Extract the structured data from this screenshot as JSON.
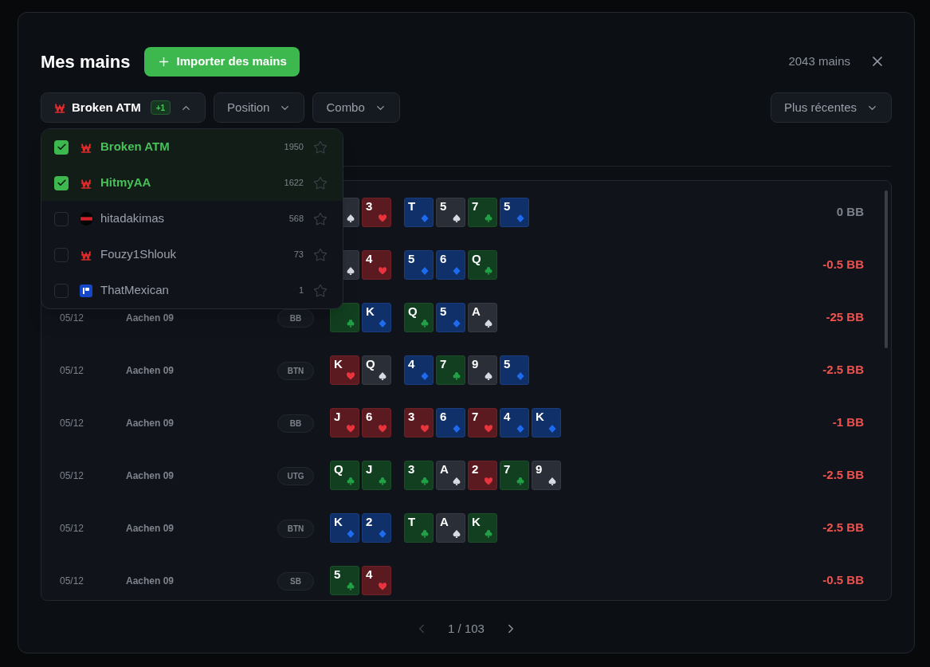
{
  "title": "Mes mains",
  "import_button": "Importer des mains",
  "hand_count": "2043 mains",
  "filters": [
    {
      "kind": "player",
      "label": "Broken ATM",
      "badge": "+1",
      "logo": {
        "kind": "w"
      },
      "expanded": true
    },
    {
      "kind": "plain",
      "label": "Position",
      "expanded": false
    },
    {
      "kind": "plain",
      "label": "Combo",
      "expanded": false
    }
  ],
  "sort": {
    "label": "Plus récentes"
  },
  "players": [
    {
      "name": "Broken ATM",
      "count": "1950",
      "checked": true,
      "logo": {
        "kind": "w"
      }
    },
    {
      "name": "HitmyAA",
      "count": "1622",
      "checked": true,
      "logo": {
        "kind": "w"
      }
    },
    {
      "name": "hitadakimas",
      "count": "568",
      "checked": false,
      "logo": {
        "kind": "redblack"
      }
    },
    {
      "name": "Fouzy1Shlouk",
      "count": "73",
      "checked": false,
      "logo": {
        "kind": "w"
      }
    },
    {
      "name": "ThatMexican",
      "count": "1",
      "checked": false,
      "logo": {
        "kind": "blue"
      }
    }
  ],
  "hands": [
    {
      "hole": [
        {
          "kind": "spade"
        },
        {
          "rank": "3",
          "kind": "heart"
        }
      ],
      "board": [
        {
          "rank": "T",
          "kind": "diamond"
        },
        {
          "rank": "5",
          "kind": "spade"
        },
        {
          "rank": "7",
          "kind": "club"
        },
        {
          "rank": "5",
          "kind": "diamond"
        }
      ],
      "result": "0 BB",
      "kind": "even"
    },
    {
      "hole": [
        {
          "kind": "spade"
        },
        {
          "rank": "4",
          "kind": "heart"
        }
      ],
      "board": [
        {
          "rank": "5",
          "kind": "diamond"
        },
        {
          "rank": "6",
          "kind": "diamond"
        },
        {
          "rank": "Q",
          "kind": "club"
        }
      ],
      "result": "-0.5 BB",
      "kind": "loss"
    },
    {
      "date": "05/12",
      "table": "Aachen 09",
      "position": "BB",
      "hole": [
        {
          "kind": "club"
        },
        {
          "rank": "K",
          "kind": "diamond"
        }
      ],
      "board": [
        {
          "rank": "Q",
          "kind": "club"
        },
        {
          "rank": "5",
          "kind": "diamond"
        },
        {
          "rank": "A",
          "kind": "spade"
        }
      ],
      "result": "-25 BB",
      "kind": "loss"
    },
    {
      "date": "05/12",
      "table": "Aachen 09",
      "position": "BTN",
      "hole": [
        {
          "rank": "K",
          "kind": "heart"
        },
        {
          "rank": "Q",
          "kind": "spade"
        }
      ],
      "board": [
        {
          "rank": "4",
          "kind": "diamond"
        },
        {
          "rank": "7",
          "kind": "club"
        },
        {
          "rank": "9",
          "kind": "spade"
        },
        {
          "rank": "5",
          "kind": "diamond"
        }
      ],
      "result": "-2.5 BB",
      "kind": "loss"
    },
    {
      "date": "05/12",
      "table": "Aachen 09",
      "position": "BB",
      "hole": [
        {
          "rank": "J",
          "kind": "heart"
        },
        {
          "rank": "6",
          "kind": "heart"
        }
      ],
      "board": [
        {
          "rank": "3",
          "kind": "heart"
        },
        {
          "rank": "6",
          "kind": "diamond"
        },
        {
          "rank": "7",
          "kind": "heart"
        },
        {
          "rank": "4",
          "kind": "diamond"
        },
        {
          "rank": "K",
          "kind": "diamond"
        }
      ],
      "result": "-1 BB",
      "kind": "loss"
    },
    {
      "date": "05/12",
      "table": "Aachen 09",
      "position": "UTG",
      "hole": [
        {
          "rank": "Q",
          "kind": "club"
        },
        {
          "rank": "J",
          "kind": "club"
        }
      ],
      "board": [
        {
          "rank": "3",
          "kind": "club"
        },
        {
          "rank": "A",
          "kind": "spade"
        },
        {
          "rank": "2",
          "kind": "heart"
        },
        {
          "rank": "7",
          "kind": "club"
        },
        {
          "rank": "9",
          "kind": "spade"
        }
      ],
      "result": "-2.5 BB",
      "kind": "loss"
    },
    {
      "date": "05/12",
      "table": "Aachen 09",
      "position": "BTN",
      "hole": [
        {
          "rank": "K",
          "kind": "diamond"
        },
        {
          "rank": "2",
          "kind": "diamond"
        }
      ],
      "board": [
        {
          "rank": "T",
          "kind": "club"
        },
        {
          "rank": "A",
          "kind": "spade"
        },
        {
          "rank": "K",
          "kind": "club"
        }
      ],
      "result": "-2.5 BB",
      "kind": "loss"
    },
    {
      "date": "05/12",
      "table": "Aachen 09",
      "position": "SB",
      "hole": [
        {
          "rank": "5",
          "kind": "club"
        },
        {
          "rank": "4",
          "kind": "heart"
        }
      ],
      "result": "-0.5 BB",
      "kind": "loss"
    }
  ],
  "pagination": {
    "label": "1 / 103"
  }
}
